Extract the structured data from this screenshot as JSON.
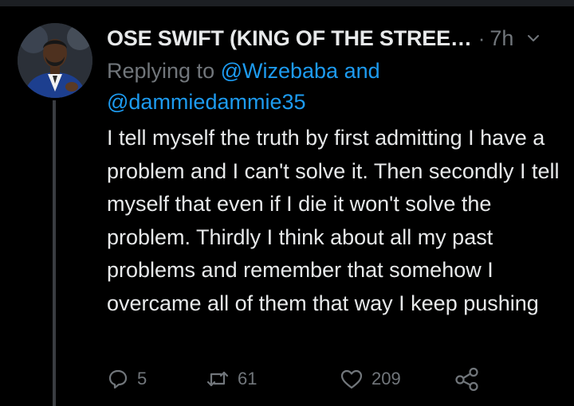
{
  "tweet": {
    "display_name": "OSE SWIFT (KING OF THE STREE…",
    "separator": "·",
    "time": "7h",
    "replying_prefix": "Replying to ",
    "reply_handle_1": "@Wizebaba",
    "reply_joiner": " and",
    "reply_handle_2": "@dammiedammie35",
    "text": "I tell myself the truth by first admitting I have a problem and I can't solve it. Then secondly I tell myself that even if I die it won't solve the problem. Thirdly I think about all my past problems and remember that somehow I overcame all of them that way I keep pushing"
  },
  "actions": {
    "reply_count": "5",
    "retweet_count": "61",
    "like_count": "209"
  },
  "icons": {
    "reply": "reply-icon",
    "retweet": "retweet-icon",
    "like": "heart-icon",
    "share": "share-icon",
    "more": "chevron-down-icon"
  },
  "colors": {
    "background": "#000000",
    "text_primary": "#e7e9ea",
    "text_secondary": "#71767b",
    "link": "#1d9bf0",
    "thread_line": "#3a3d42"
  }
}
